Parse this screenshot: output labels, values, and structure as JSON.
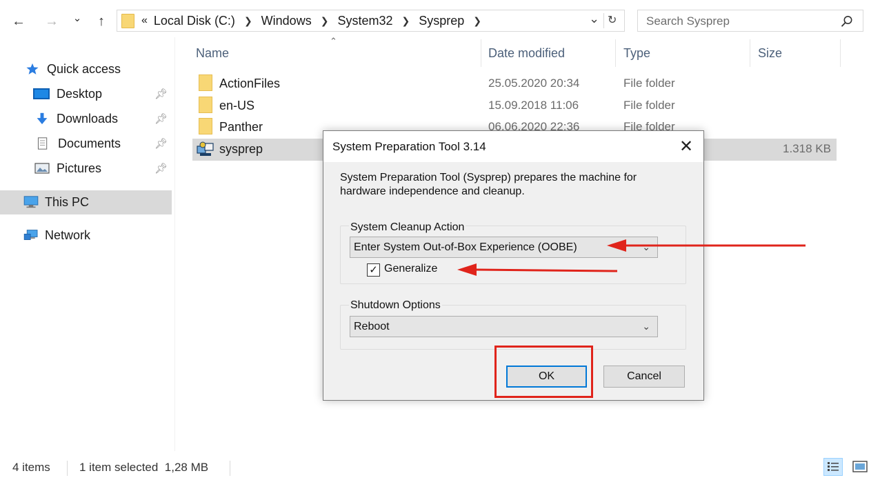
{
  "nav_buttons": {
    "back": "←",
    "forward": "→",
    "recent": "⌄",
    "up": "↑"
  },
  "address": {
    "overflow": "«",
    "crumbs": [
      "Local Disk (C:)",
      "Windows",
      "System32",
      "Sysprep"
    ],
    "dropdown_glyph": "⌄",
    "refresh_glyph": "↻"
  },
  "search": {
    "placeholder": "Search Sysprep"
  },
  "nav_pane": {
    "quick_access": "Quick access",
    "items": [
      {
        "label": "Desktop",
        "pinned": true
      },
      {
        "label": "Downloads",
        "pinned": true
      },
      {
        "label": "Documents",
        "pinned": true
      },
      {
        "label": "Pictures",
        "pinned": true
      }
    ],
    "this_pc": "This PC",
    "network": "Network"
  },
  "columns": {
    "name": "Name",
    "date": "Date modified",
    "type": "Type",
    "size": "Size"
  },
  "files": [
    {
      "name": "ActionFiles",
      "date": "25.05.2020 20:34",
      "type": "File folder",
      "size": ""
    },
    {
      "name": "en-US",
      "date": "15.09.2018 11:06",
      "type": "File folder",
      "size": ""
    },
    {
      "name": "Panther",
      "date": "06.06.2020 22:36",
      "type": "File folder",
      "size": ""
    },
    {
      "name": "sysprep",
      "date": "",
      "type": "",
      "size": "1.318 KB"
    }
  ],
  "status": {
    "count": "4 items",
    "selection": "1 item selected  1,28 MB"
  },
  "dialog": {
    "title": "System Preparation Tool 3.14",
    "close": "✕",
    "description": "System Preparation Tool (Sysprep) prepares the machine for hardware independence and cleanup.",
    "cleanup_group": "System Cleanup Action",
    "cleanup_value": "Enter System Out-of-Box Experience (OOBE)",
    "generalize_label": "Generalize",
    "generalize_checked": true,
    "shutdown_group": "Shutdown Options",
    "shutdown_value": "Reboot",
    "ok": "OK",
    "cancel": "Cancel"
  },
  "colors": {
    "annotation": "#e0241b",
    "accent": "#0078d7",
    "selection": "#d9d9d9"
  }
}
